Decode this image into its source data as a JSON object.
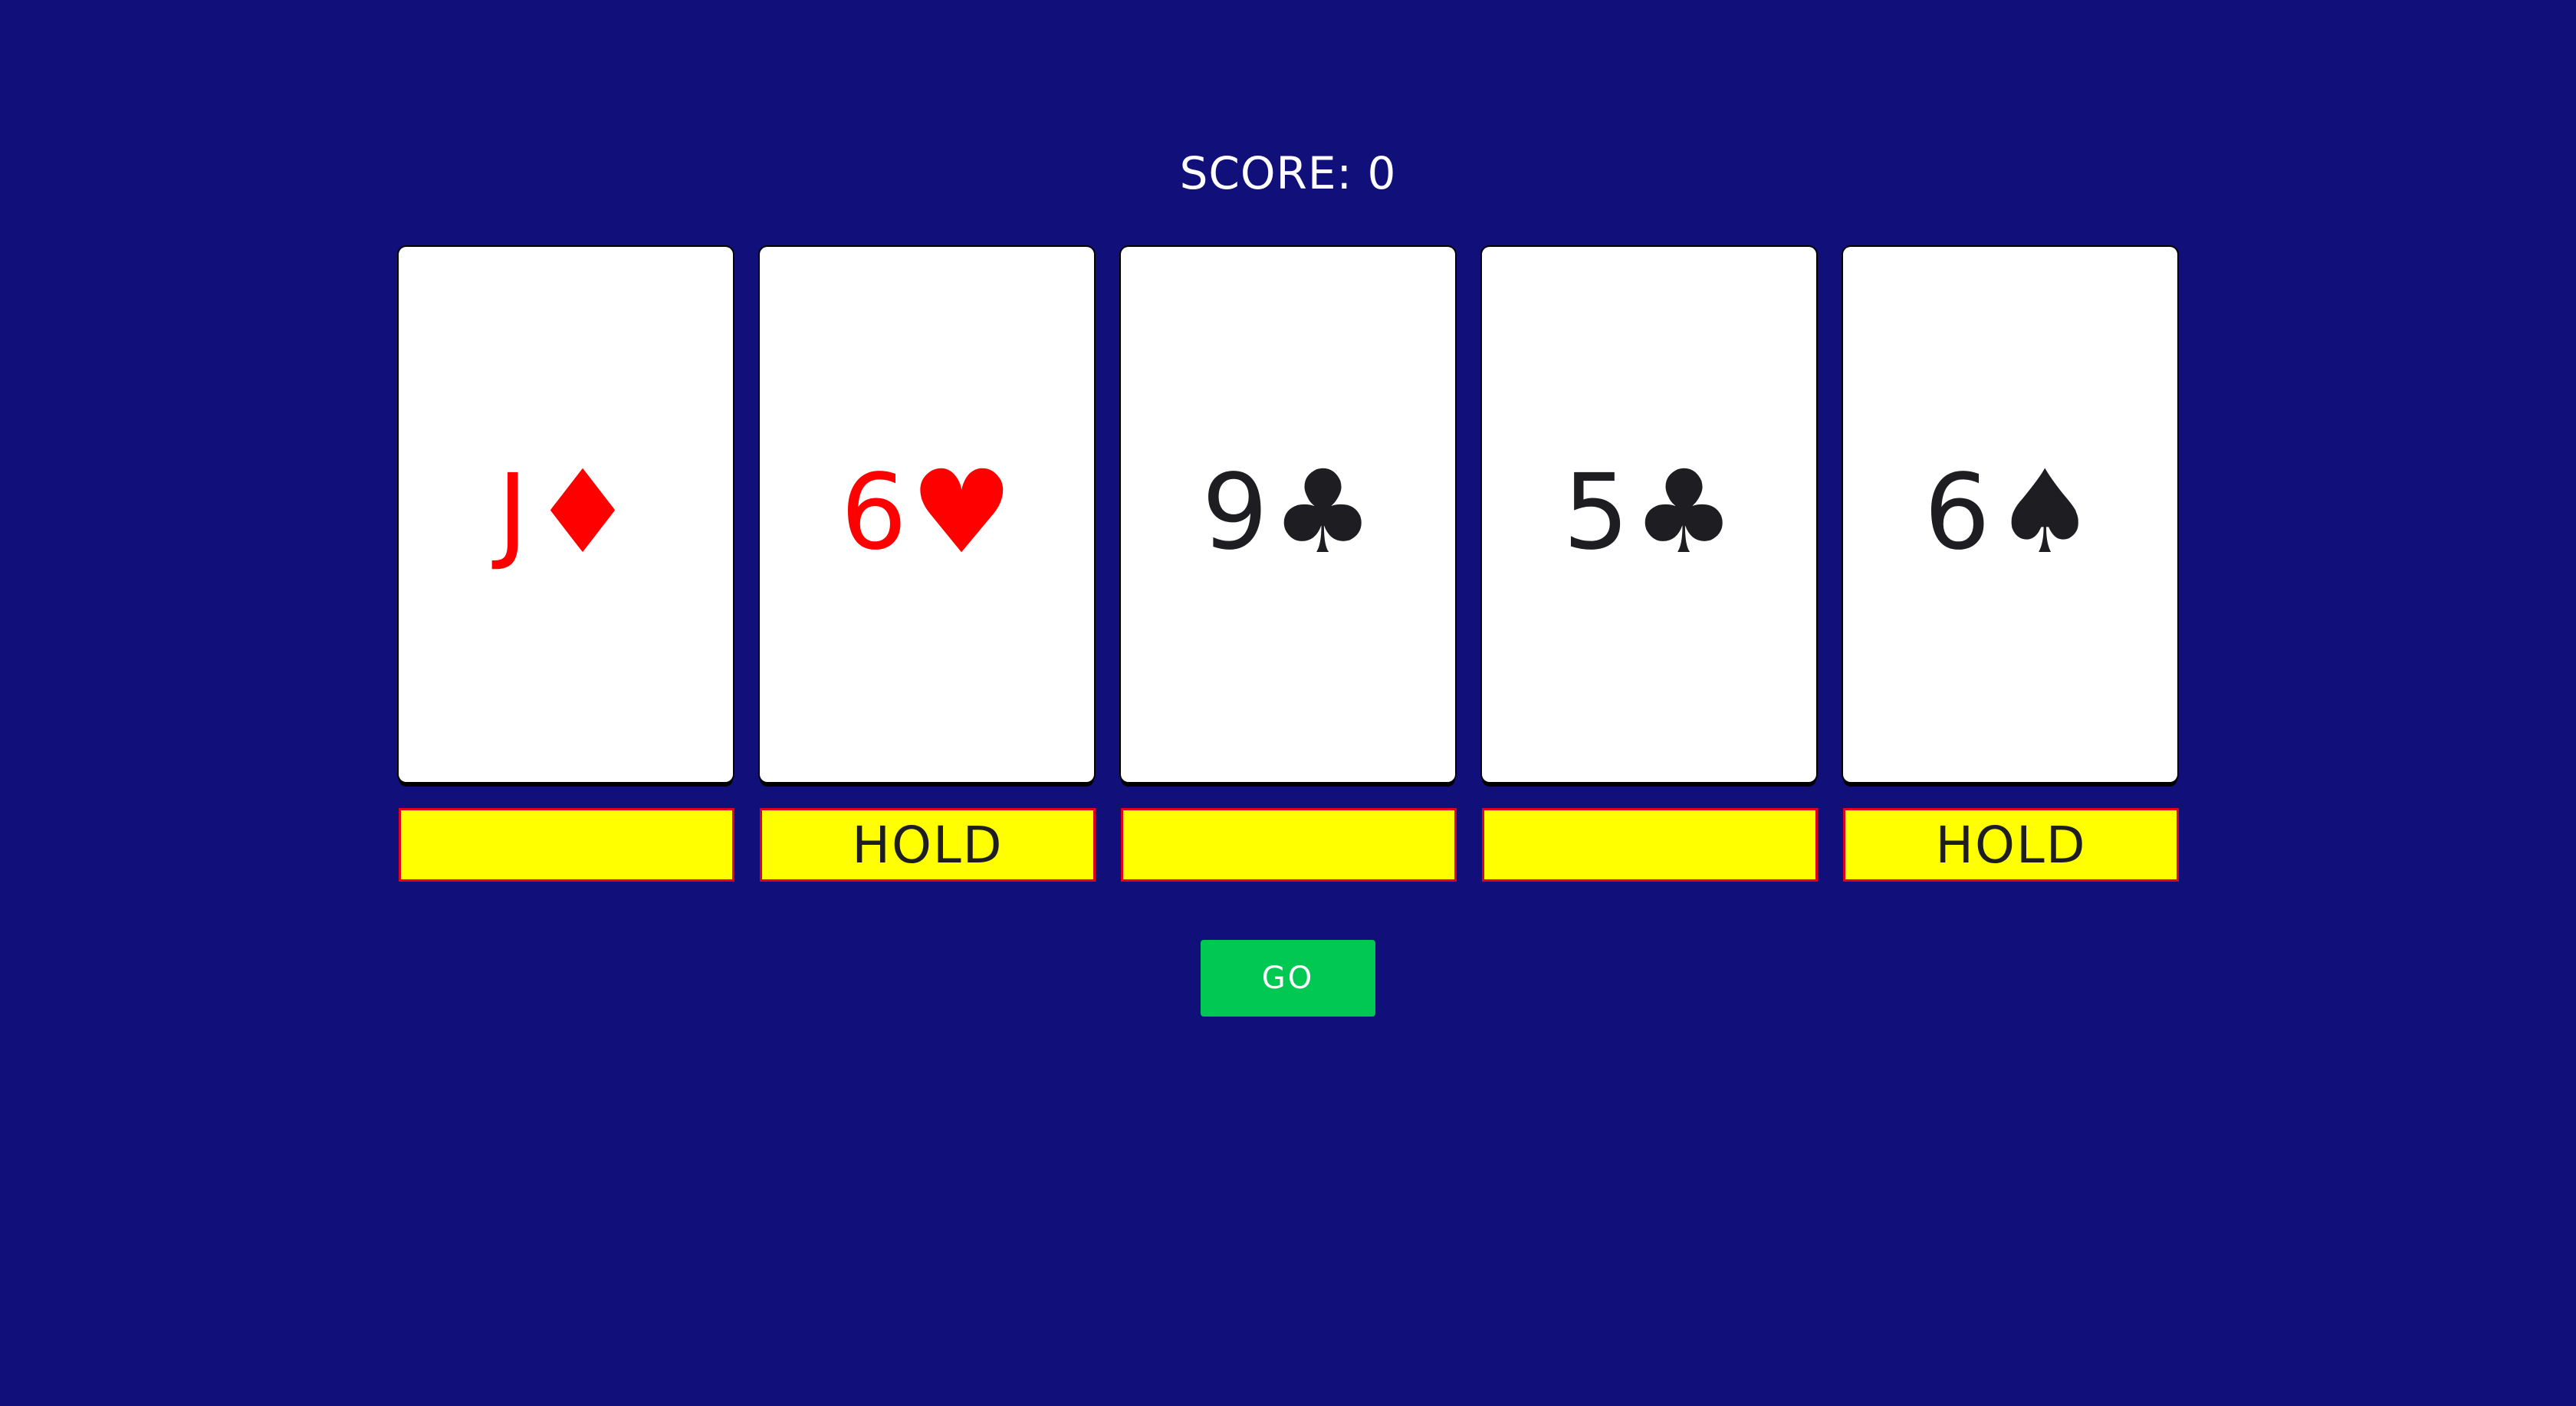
{
  "score": {
    "text": "SCORE: 0"
  },
  "cards": [
    {
      "rank": "J",
      "suit": "♦",
      "suit_name": "diamonds",
      "color": "#ff0000",
      "hold_label": ""
    },
    {
      "rank": "6",
      "suit": "♥",
      "suit_name": "hearts",
      "color": "#ff0000",
      "hold_label": "HOLD"
    },
    {
      "rank": "9",
      "suit": "♣",
      "suit_name": "clubs",
      "color": "#1e1e22",
      "hold_label": ""
    },
    {
      "rank": "5",
      "suit": "♣",
      "suit_name": "clubs",
      "color": "#1e1e22",
      "hold_label": ""
    },
    {
      "rank": "6",
      "suit": "♠",
      "suit_name": "spades",
      "color": "#1e1e22",
      "hold_label": "HOLD"
    }
  ],
  "go_button": {
    "label": "GO",
    "color": "#00c853"
  },
  "colors": {
    "background": "#11107a",
    "hold_background": "#ffff00",
    "hold_border": "#e2001a"
  }
}
